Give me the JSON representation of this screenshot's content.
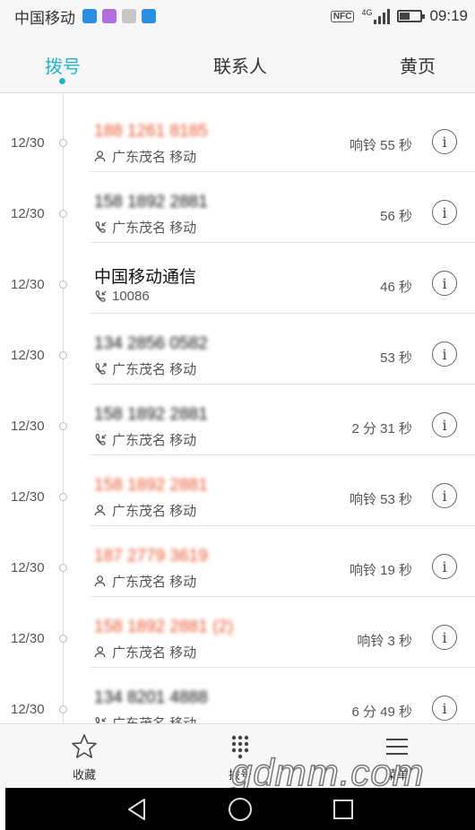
{
  "status_bar": {
    "carrier": "中国移动",
    "nfc": "NFC",
    "network": "4G",
    "time": "09:19",
    "battery_level": 0.45
  },
  "tabs": [
    {
      "label": "拨号",
      "active": true
    },
    {
      "label": "联系人",
      "active": false
    },
    {
      "label": "黄页",
      "active": false
    }
  ],
  "calls": [
    {
      "date": "12/30",
      "name": "188 1261 8185",
      "missed": true,
      "blurred": true,
      "icon": "missed-person-icon",
      "sub": "广东茂名 移动",
      "duration": "响铃 55 秒"
    },
    {
      "date": "12/30",
      "name": "158 1892 2881",
      "missed": false,
      "blurred": true,
      "icon": "incoming-call-icon",
      "sub": "广东茂名 移动",
      "duration": "56 秒"
    },
    {
      "date": "12/30",
      "name": "中国移动通信",
      "missed": false,
      "blurred": false,
      "icon": "incoming-call-icon",
      "sub": "10086",
      "duration": "46 秒"
    },
    {
      "date": "12/30",
      "name": "134 2856 0582",
      "missed": false,
      "blurred": true,
      "icon": "outgoing-call-icon",
      "sub": "广东茂名 移动",
      "duration": "53 秒"
    },
    {
      "date": "12/30",
      "name": "158 1892 2881",
      "missed": false,
      "blurred": true,
      "icon": "incoming-call-icon",
      "sub": "广东茂名 移动",
      "duration": "2 分 31 秒"
    },
    {
      "date": "12/30",
      "name": "158 1892 2881",
      "missed": true,
      "blurred": true,
      "icon": "missed-person-icon",
      "sub": "广东茂名 移动",
      "duration": "响铃 53 秒"
    },
    {
      "date": "12/30",
      "name": "187 2779 3619",
      "missed": true,
      "blurred": true,
      "icon": "missed-person-icon",
      "sub": "广东茂名 移动",
      "duration": "响铃 19 秒"
    },
    {
      "date": "12/30",
      "name": "158 1892 2881 (2)",
      "missed": true,
      "blurred": true,
      "icon": "missed-person-icon",
      "sub": "广东茂名 移动",
      "duration": "响铃 3 秒"
    },
    {
      "date": "12/30",
      "name": "134 8201 4888",
      "missed": false,
      "blurred": true,
      "icon": "incoming-call-icon",
      "sub": "广东茂名 移动",
      "duration": "6 分 49 秒"
    }
  ],
  "bottom_bar": {
    "favorites_label": "收藏",
    "dialpad_label": "拨号",
    "menu_label": "菜单"
  },
  "watermark": "gdmm.com"
}
